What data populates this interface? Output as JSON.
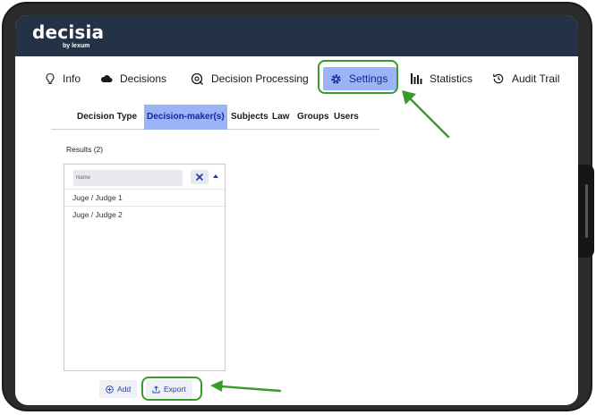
{
  "app": {
    "logo": "decisia",
    "logo_sub": "by lexum"
  },
  "nav": {
    "info": "Info",
    "decisions": "Decisions",
    "processing": "Decision Processing",
    "settings": "Settings",
    "statistics": "Statistics",
    "audit": "Audit Trail"
  },
  "subtabs": {
    "decision_type": "Decision Type",
    "decision_makers": "Decision-maker(s)",
    "subjects": "Subjects",
    "law": "Law",
    "groups": "Groups",
    "users": "Users"
  },
  "results": {
    "label": "Results (2)",
    "search_placeholder": "Name",
    "items": [
      "Juge / Judge 1",
      "Juge / Judge 2"
    ]
  },
  "actions": {
    "add": "Add",
    "export": "Export"
  },
  "colors": {
    "topbar": "#243246",
    "active_tab": "#9ab4f5",
    "highlight": "#3a9a2b",
    "link": "#2a3fa8"
  },
  "icons": {
    "info": "lightbulb-icon",
    "decisions": "cloud-icon",
    "processing": "gear-pin-icon",
    "settings": "gear-icon",
    "statistics": "bar-chart-icon",
    "audit": "history-icon",
    "clear": "close-icon",
    "sort": "caret-up-icon",
    "add": "plus-circle-icon",
    "export": "export-icon"
  }
}
